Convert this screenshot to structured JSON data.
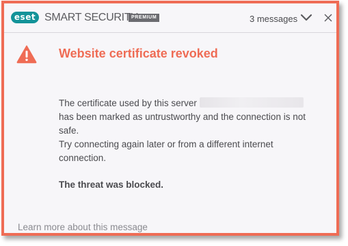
{
  "header": {
    "logo_text": "eset",
    "product_name": "SMART SECURITY",
    "edition": "PREMIUM",
    "messages_label": "3 messages"
  },
  "alert": {
    "icon": "warning-triangle-icon",
    "title": "Website certificate revoked",
    "line1_prefix": "The certificate used by this server",
    "line2": "has been marked as untrustworthy and the connection is not safe.",
    "line3": "Try connecting again later or from a different internet connection.",
    "verdict": "The threat was blocked."
  },
  "footer": {
    "learn_more": "Learn more about this message"
  },
  "colors": {
    "accent": "#ef6c55",
    "brand_teal": "#139399",
    "text": "#4a4a4e",
    "link": "#8a8a90",
    "background": "#f7f6f9"
  }
}
